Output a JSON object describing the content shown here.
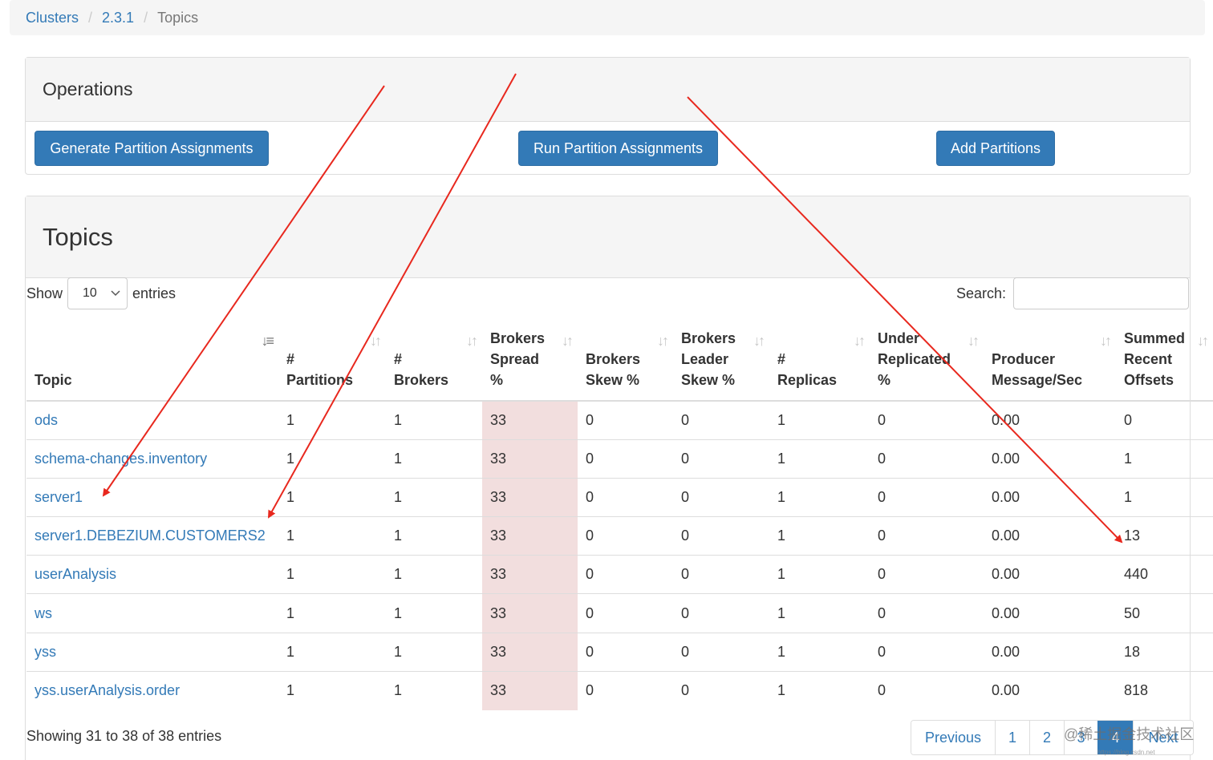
{
  "breadcrumb": {
    "items": [
      "Clusters",
      "2.3.1"
    ],
    "active": "Topics",
    "separator": "/"
  },
  "operations": {
    "title": "Operations",
    "generate_label": "Generate Partition Assignments",
    "run_label": "Run Partition Assignments",
    "add_label": "Add Partitions"
  },
  "topics": {
    "title": "Topics",
    "show_label": "Show",
    "page_size": "10",
    "entries_label": "entries",
    "search_label": "Search:",
    "search_value": "",
    "columns": [
      [
        "Topic"
      ],
      [
        "#",
        "Partitions"
      ],
      [
        "#",
        "Brokers"
      ],
      [
        "Brokers",
        "Spread",
        "%"
      ],
      [
        "Brokers",
        "Skew %"
      ],
      [
        "Brokers",
        "Leader",
        "Skew %"
      ],
      [
        "#",
        "Replicas"
      ],
      [
        "Under",
        "Replicated",
        "%"
      ],
      [
        "Producer",
        "Message/Sec"
      ],
      [
        "Summed",
        "Recent",
        "Offsets"
      ]
    ],
    "rows": [
      [
        "ods",
        "1",
        "1",
        "33",
        "0",
        "0",
        "1",
        "0",
        "0.00",
        "0"
      ],
      [
        "schema-changes.inventory",
        "1",
        "1",
        "33",
        "0",
        "0",
        "1",
        "0",
        "0.00",
        "1"
      ],
      [
        "server1",
        "1",
        "1",
        "33",
        "0",
        "0",
        "1",
        "0",
        "0.00",
        "1"
      ],
      [
        "server1.DEBEZIUM.CUSTOMERS2",
        "1",
        "1",
        "33",
        "0",
        "0",
        "1",
        "0",
        "0.00",
        "13"
      ],
      [
        "userAnalysis",
        "1",
        "1",
        "33",
        "0",
        "0",
        "1",
        "0",
        "0.00",
        "440"
      ],
      [
        "ws",
        "1",
        "1",
        "33",
        "0",
        "0",
        "1",
        "0",
        "0.00",
        "50"
      ],
      [
        "yss",
        "1",
        "1",
        "33",
        "0",
        "0",
        "1",
        "0",
        "0.00",
        "18"
      ],
      [
        "yss.userAnalysis.order",
        "1",
        "1",
        "33",
        "0",
        "0",
        "1",
        "0",
        "0.00",
        "818"
      ]
    ],
    "info": "Showing 31 to 38 of 38 entries",
    "pagination": [
      "Previous",
      "1",
      "2",
      "3",
      "4",
      "Next"
    ],
    "active_page": "4"
  },
  "watermark": {
    "text": "@稀土掘金技术社区",
    "sub": "https://blog.csdn.net"
  },
  "icons": {
    "sort": "sort-icon",
    "sort_active": "sort-asc-icon",
    "select_caret": "chevron-down-icon"
  },
  "colors": {
    "primary": "#337ab7",
    "highlight": "#f2dede",
    "annotation": "#e8281e"
  }
}
